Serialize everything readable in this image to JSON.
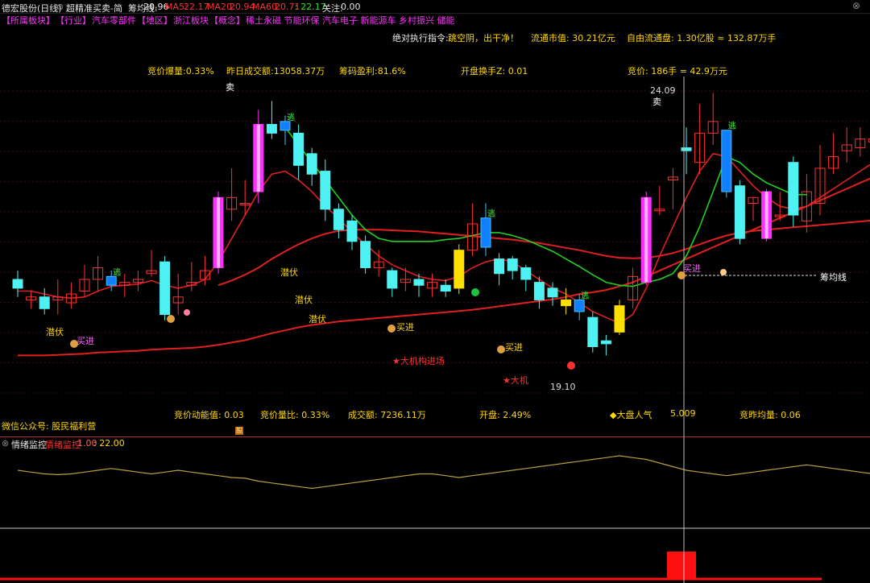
{
  "header": {
    "stock": "德宏股份(日线)",
    "formula": "超精准买卖-简",
    "chip_line_label": "筹均线:",
    "chip_line_value": "20.96",
    "ma5_label": "MA5:",
    "ma5_value": "22.17",
    "ma20_label": "MA20:",
    "ma20_value": "20.94",
    "ma60_label": "MA60:",
    "ma60_value": "20.71",
    "extra_value": ": 22.17",
    "focus_label": "关注:",
    "focus_value": "0.00"
  },
  "sectors": [
    {
      "text": "【所属板块】",
      "color": "#ff33ff"
    },
    {
      "text": "【行业】",
      "color": "#ff33ff"
    },
    {
      "text": "汽车零部件",
      "color": "#ff33ff"
    },
    {
      "text": "【地区】",
      "color": "#ff33ff"
    },
    {
      "text": "浙江板块",
      "color": "#ff33ff"
    },
    {
      "text": "【概念】",
      "color": "#ff33ff"
    },
    {
      "text": "稀土永磁 节能环保 汽车电子 新能源车 乡村振兴 储能",
      "color": "#ff33ff"
    }
  ],
  "info_row1": {
    "command_label": "绝对执行指令:",
    "command_value": "跳空阴，出干净！",
    "market_cap": "流通市值: 30.21亿元",
    "free_float": "自由流通盘: 1.30亿股 ≈ 132.87万手"
  },
  "info_row2": {
    "bid_explode": "竞价爆量:0.33%",
    "prev_turnover": "昨日成交额:13058.37万",
    "chip_profit": "筹码盈利:81.6%",
    "open_turnover": "开盘换手Z: 0.01",
    "bid_price": "竞价: 186手 = 42.9万元"
  },
  "chart_labels": {
    "sell1": "卖",
    "sell2": "卖",
    "high_price": "24.09",
    "low_price": "19.10",
    "chip_line_name": "筹均线",
    "lurk1": "潜伏",
    "lurk2": "潜伏",
    "lurk3": "潜伏",
    "lurk4": "潜伏",
    "buy1": "买进",
    "buy2": "买进",
    "buy3": "买进",
    "buy4": "买进",
    "inst1": "★大机构进场",
    "inst2": "★大机",
    "escape": "逃"
  },
  "info_row3": {
    "bid_momentum": "竞价动能值: 0.03",
    "bid_ratio": "竞价量比: 0.33%",
    "volume": "成交额: 7236.11万",
    "open": "开盘: 2.49%",
    "popularity_label": "◆大盘人气",
    "popularity_value": "5.009",
    "bid_avg": "竞昨均量: 0.06"
  },
  "wechat": "微信公众号: 股民福利营",
  "sub_panel": {
    "title": "情绪监控",
    "subtitle": "情绪监控",
    "value1": "1.00",
    "value2": ": 22.00"
  },
  "colors": {
    "bg": "#000000",
    "up_candle": "#ff3030",
    "down_candle": "#4ff2f2",
    "ma_red": "#e02020",
    "ma_green": "#20d020",
    "grid": "#3a0c0c",
    "cursor": "#bbbbbb",
    "sub_line": "#b8a040",
    "bar_red": "#ff1010"
  },
  "chart_data": {
    "type": "candlestick",
    "candles": [
      {
        "o": 20.9,
        "c": 20.75,
        "h": 21.05,
        "l": 20.6,
        "style": "down"
      },
      {
        "o": 20.55,
        "c": 20.6,
        "h": 20.7,
        "l": 20.4,
        "style": "doji"
      },
      {
        "o": 20.6,
        "c": 20.4,
        "h": 20.75,
        "l": 20.3,
        "style": "down"
      },
      {
        "o": 20.55,
        "c": 20.6,
        "h": 20.9,
        "l": 20.3,
        "style": "doji"
      },
      {
        "o": 20.5,
        "c": 20.65,
        "h": 20.85,
        "l": 20.4,
        "style": "up"
      },
      {
        "o": 20.7,
        "c": 20.9,
        "h": 21.15,
        "l": 20.6,
        "style": "up"
      },
      {
        "o": 20.9,
        "c": 21.1,
        "h": 21.3,
        "l": 20.7,
        "style": "up"
      },
      {
        "o": 20.95,
        "c": 20.8,
        "h": 21.05,
        "l": 20.7,
        "style": "escape"
      },
      {
        "o": 20.8,
        "c": 20.85,
        "h": 21.0,
        "l": 20.6,
        "style": "doji"
      },
      {
        "o": 20.85,
        "c": 20.9,
        "h": 21.05,
        "l": 20.7,
        "style": "doji"
      },
      {
        "o": 21.0,
        "c": 21.05,
        "h": 21.4,
        "l": 20.95,
        "style": "doji"
      },
      {
        "o": 21.2,
        "c": 20.3,
        "h": 21.3,
        "l": 20.2,
        "style": "down"
      },
      {
        "o": 20.5,
        "c": 20.6,
        "h": 21.0,
        "l": 20.3,
        "style": "doji"
      },
      {
        "o": 20.8,
        "c": 20.85,
        "h": 21.2,
        "l": 20.7,
        "style": "doji"
      },
      {
        "o": 20.9,
        "c": 21.05,
        "h": 21.3,
        "l": 20.8,
        "style": "up"
      },
      {
        "o": 21.1,
        "c": 22.3,
        "h": 22.4,
        "l": 21.0,
        "style": "pump"
      },
      {
        "o": 22.1,
        "c": 22.3,
        "h": 22.8,
        "l": 21.9,
        "style": "up"
      },
      {
        "o": 22.2,
        "c": 22.2,
        "h": 22.6,
        "l": 22.0,
        "style": "doji"
      },
      {
        "o": 22.4,
        "c": 23.55,
        "h": 23.8,
        "l": 22.2,
        "style": "pump"
      },
      {
        "o": 23.55,
        "c": 23.4,
        "h": 23.95,
        "l": 23.3,
        "style": "down"
      },
      {
        "o": 23.6,
        "c": 23.45,
        "h": 23.7,
        "l": 23.2,
        "style": "escape"
      },
      {
        "o": 23.4,
        "c": 22.85,
        "h": 23.55,
        "l": 22.6,
        "style": "down"
      },
      {
        "o": 23.05,
        "c": 22.7,
        "h": 23.15,
        "l": 22.5,
        "style": "down"
      },
      {
        "o": 22.75,
        "c": 22.1,
        "h": 22.95,
        "l": 21.9,
        "style": "down"
      },
      {
        "o": 22.1,
        "c": 21.75,
        "h": 22.2,
        "l": 21.6,
        "style": "down"
      },
      {
        "o": 21.9,
        "c": 21.55,
        "h": 22.0,
        "l": 21.4,
        "style": "down"
      },
      {
        "o": 21.55,
        "c": 21.1,
        "h": 21.65,
        "l": 21.0,
        "style": "down"
      },
      {
        "o": 21.1,
        "c": 21.2,
        "h": 21.4,
        "l": 20.95,
        "style": "up"
      },
      {
        "o": 21.05,
        "c": 20.75,
        "h": 21.1,
        "l": 20.6,
        "style": "down"
      },
      {
        "o": 20.85,
        "c": 20.9,
        "h": 21.1,
        "l": 20.7,
        "style": "up"
      },
      {
        "o": 20.9,
        "c": 20.8,
        "h": 21.0,
        "l": 20.6,
        "style": "down"
      },
      {
        "o": 20.75,
        "c": 20.85,
        "h": 21.0,
        "l": 20.6,
        "style": "up"
      },
      {
        "o": 20.8,
        "c": 20.7,
        "h": 20.9,
        "l": 20.6,
        "style": "down"
      },
      {
        "o": 20.75,
        "c": 21.4,
        "h": 21.5,
        "l": 20.65,
        "style": "yellow"
      },
      {
        "o": 21.4,
        "c": 21.85,
        "h": 22.2,
        "l": 21.3,
        "style": "up"
      },
      {
        "o": 21.95,
        "c": 21.45,
        "h": 22.2,
        "l": 21.3,
        "style": "escape"
      },
      {
        "o": 21.25,
        "c": 21.0,
        "h": 21.35,
        "l": 20.8,
        "style": "down"
      },
      {
        "o": 21.25,
        "c": 21.05,
        "h": 21.3,
        "l": 20.9,
        "style": "down"
      },
      {
        "o": 21.1,
        "c": 20.9,
        "h": 21.15,
        "l": 20.7,
        "style": "down"
      },
      {
        "o": 20.85,
        "c": 20.55,
        "h": 20.95,
        "l": 20.4,
        "style": "down"
      },
      {
        "o": 20.75,
        "c": 20.6,
        "h": 20.85,
        "l": 20.45,
        "style": "down"
      },
      {
        "o": 20.55,
        "c": 20.45,
        "h": 20.75,
        "l": 20.3,
        "style": "yellow"
      },
      {
        "o": 20.55,
        "c": 20.35,
        "h": 20.65,
        "l": 20.2,
        "style": "escape"
      },
      {
        "o": 20.25,
        "c": 19.75,
        "h": 20.35,
        "l": 19.65,
        "style": "down"
      },
      {
        "o": 19.85,
        "c": 19.8,
        "h": 19.95,
        "l": 19.6,
        "style": "down"
      },
      {
        "o": 20.0,
        "c": 20.45,
        "h": 20.55,
        "l": 19.95,
        "style": "yellow"
      },
      {
        "o": 20.55,
        "c": 20.95,
        "h": 21.1,
        "l": 20.4,
        "style": "up"
      },
      {
        "o": 20.85,
        "c": 22.3,
        "h": 22.4,
        "l": 20.8,
        "style": "pump"
      },
      {
        "o": 22.1,
        "c": 22.1,
        "h": 22.5,
        "l": 22.0,
        "style": "doji"
      },
      {
        "o": 22.6,
        "c": 22.65,
        "h": 22.8,
        "l": 22.1,
        "style": "doji"
      },
      {
        "o": 23.1,
        "c": 23.15,
        "h": 23.5,
        "l": 22.7,
        "style": "down"
      },
      {
        "o": 22.9,
        "c": 23.4,
        "h": 23.9,
        "l": 22.7,
        "style": "up"
      },
      {
        "o": 23.4,
        "c": 23.6,
        "h": 24.09,
        "l": 23.2,
        "style": "up"
      },
      {
        "o": 23.45,
        "c": 22.4,
        "h": 23.45,
        "l": 22.3,
        "style": "escape"
      },
      {
        "o": 22.5,
        "c": 21.6,
        "h": 22.6,
        "l": 21.5,
        "style": "down"
      },
      {
        "o": 22.2,
        "c": 22.3,
        "h": 22.3,
        "l": 21.9,
        "style": "doji"
      },
      {
        "o": 22.4,
        "c": 21.6,
        "h": 22.45,
        "l": 21.55,
        "style": "pump"
      },
      {
        "o": 22.0,
        "c": 22.0,
        "h": 22.4,
        "l": 21.9,
        "style": "doji"
      },
      {
        "o": 22.9,
        "c": 22.0,
        "h": 23.0,
        "l": 21.8,
        "style": "down"
      },
      {
        "o": 21.9,
        "c": 22.4,
        "h": 22.7,
        "l": 21.7,
        "style": "up"
      },
      {
        "o": 22.2,
        "c": 22.8,
        "h": 23.2,
        "l": 22.0,
        "style": "up"
      },
      {
        "o": 22.8,
        "c": 23.0,
        "h": 23.4,
        "l": 22.7,
        "style": "up"
      },
      {
        "o": 23.1,
        "c": 23.2,
        "h": 23.5,
        "l": 22.9,
        "style": "up"
      },
      {
        "o": 23.15,
        "c": 23.3,
        "h": 23.5,
        "l": 23.0,
        "style": "up"
      },
      {
        "o": 23.3,
        "c": 23.25,
        "h": 23.6,
        "l": 23.0,
        "style": "up"
      },
      {
        "o": 23.45,
        "c": 23.6,
        "h": 23.7,
        "l": 23.1,
        "style": "up"
      },
      {
        "o": 23.4,
        "c": 22.9,
        "h": 23.7,
        "l": 22.8,
        "style": "escape"
      },
      {
        "o": 23.2,
        "c": 23.0,
        "h": 23.4,
        "l": 22.8,
        "style": "down"
      }
    ],
    "ma_red_fast": [
      20.7,
      20.7,
      20.65,
      20.6,
      20.58,
      20.6,
      20.7,
      20.78,
      20.8,
      20.82,
      20.88,
      20.8,
      20.75,
      20.8,
      20.9,
      21.2,
      21.6,
      22.0,
      22.4,
      22.7,
      22.75,
      22.6,
      22.4,
      22.15,
      21.95,
      21.7,
      21.5,
      21.3,
      21.15,
      21.05,
      20.95,
      20.9,
      20.88,
      20.95,
      21.1,
      21.2,
      21.25,
      21.2,
      21.05,
      20.9,
      20.75,
      20.65,
      20.5,
      20.35,
      20.25,
      20.15,
      20.3,
      20.75,
      21.3,
      21.8,
      22.3,
      22.75,
      23.05,
      23.0,
      22.75,
      22.5,
      22.3,
      22.15,
      22.1,
      22.15,
      22.3,
      22.45,
      22.6,
      22.75,
      22.9,
      23.1,
      23.2,
      23.25
    ],
    "ma_green": [
      null,
      null,
      null,
      null,
      null,
      null,
      null,
      null,
      null,
      null,
      null,
      null,
      null,
      null,
      null,
      null,
      null,
      null,
      null,
      null,
      23.5,
      23.2,
      22.9,
      22.6,
      22.3,
      22.0,
      21.75,
      21.6,
      21.55,
      21.55,
      21.55,
      21.55,
      21.58,
      21.6,
      21.65,
      21.7,
      21.7,
      21.65,
      21.58,
      21.48,
      21.38,
      21.25,
      21.12,
      20.98,
      20.85,
      20.8,
      20.78,
      20.85,
      20.9,
      21.0,
      21.3,
      21.8,
      22.4,
      23.0,
      22.9,
      22.7,
      22.55,
      22.45,
      22.35,
      22.35
    ],
    "ma_red_slow": [
      19.6,
      19.6,
      19.6,
      19.61,
      19.62,
      19.63,
      19.65,
      19.66,
      19.67,
      19.68,
      19.7,
      19.71,
      19.72,
      19.73,
      19.75,
      19.78,
      19.82,
      19.86,
      19.92,
      19.98,
      20.03,
      20.08,
      20.12,
      20.15,
      20.18,
      20.2,
      20.22,
      20.24,
      20.26,
      20.28,
      20.3,
      20.32,
      20.34,
      20.36,
      20.38,
      20.41,
      20.44,
      20.47,
      20.5,
      20.53,
      20.56,
      20.6,
      20.65,
      20.68,
      20.72,
      20.78,
      20.85,
      20.95,
      21.05,
      21.15,
      21.25,
      21.35,
      21.45,
      21.55,
      21.65,
      21.75,
      21.85,
      21.95,
      22.05,
      22.15,
      22.25,
      22.35,
      22.45,
      22.55,
      22.65,
      22.75,
      22.85,
      22.95
    ],
    "ma_red_mid": [
      null,
      null,
      null,
      null,
      null,
      null,
      null,
      null,
      null,
      null,
      null,
      null,
      null,
      null,
      null,
      20.8,
      20.88,
      20.98,
      21.1,
      21.25,
      21.38,
      21.5,
      21.6,
      21.68,
      21.73,
      21.75,
      21.75,
      21.75,
      21.74,
      21.73,
      21.72,
      21.7,
      21.68,
      21.66,
      21.64,
      21.62,
      21.6,
      21.58,
      21.55,
      21.52,
      21.48,
      21.44,
      21.4,
      21.35,
      21.3,
      21.27,
      21.26,
      21.27,
      21.3,
      21.35,
      21.42,
      21.5,
      21.58,
      21.65,
      21.7,
      21.73,
      21.75,
      21.77,
      21.79,
      21.81,
      21.83,
      21.85,
      21.87,
      21.89,
      21.91,
      21.93,
      21.95,
      21.96
    ],
    "y_range": [
      19.0,
      24.3
    ],
    "sentiment_line": [
      22.0,
      21.95,
      21.9,
      21.88,
      21.9,
      21.95,
      22.0,
      22.05,
      22.0,
      21.95,
      21.9,
      21.95,
      22.0,
      21.95,
      21.9,
      21.85,
      21.8,
      21.78,
      21.7,
      21.65,
      21.6,
      21.55,
      21.5,
      21.55,
      21.6,
      21.65,
      21.7,
      21.75,
      21.8,
      21.85,
      21.9,
      21.9,
      21.85,
      21.8,
      21.85,
      21.9,
      21.95,
      22.0,
      22.05,
      22.1,
      22.15,
      22.2,
      22.25,
      22.3,
      22.35,
      22.4,
      22.35,
      22.3,
      22.2,
      22.1,
      22.0,
      21.95,
      21.9,
      21.85,
      21.9,
      21.95,
      22.0,
      22.05,
      22.1,
      22.15,
      22.1,
      22.05,
      22.0,
      21.95,
      21.9,
      21.92,
      21.95,
      22.0
    ],
    "sentiment_range": [
      21.2,
      22.8
    ]
  }
}
